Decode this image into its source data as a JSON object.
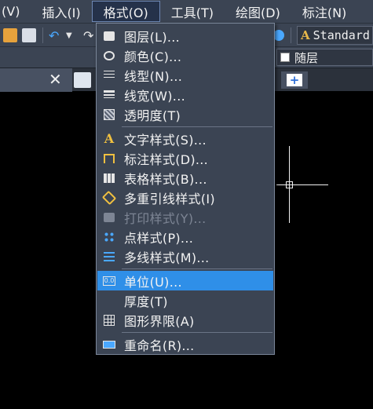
{
  "menubar": {
    "items": [
      {
        "label": "(V)"
      },
      {
        "label": "插入(I)"
      },
      {
        "label": "格式(O)"
      },
      {
        "label": "工具(T)"
      },
      {
        "label": "绘图(D)"
      },
      {
        "label": "标注(N)"
      }
    ]
  },
  "toolbar": {
    "text_style": "Standard"
  },
  "layer_bar": {
    "color_value": "随层"
  },
  "format_menu": {
    "items": [
      {
        "label": "图层(L)...",
        "icon": "layers-icon"
      },
      {
        "label": "颜色(C)...",
        "icon": "palette-icon"
      },
      {
        "label": "线型(N)...",
        "icon": "linetype-icon"
      },
      {
        "label": "线宽(W)...",
        "icon": "lineweight-icon"
      },
      {
        "label": "透明度(T)",
        "icon": "transparency-icon"
      },
      {
        "label": "文字样式(S)...",
        "icon": "text-style-icon"
      },
      {
        "label": "标注样式(D)...",
        "icon": "dimension-style-icon"
      },
      {
        "label": "表格样式(B)...",
        "icon": "table-style-icon"
      },
      {
        "label": "多重引线样式(I)",
        "icon": "multileader-style-icon"
      },
      {
        "label": "打印样式(Y)...",
        "icon": "plot-style-icon"
      },
      {
        "label": "点样式(P)...",
        "icon": "point-style-icon"
      },
      {
        "label": "多线样式(M)...",
        "icon": "multiline-style-icon"
      },
      {
        "label": "单位(U)...",
        "icon": "units-icon"
      },
      {
        "label": "厚度(T)",
        "icon": ""
      },
      {
        "label": "图形界限(A)",
        "icon": "drawing-limits-icon"
      },
      {
        "label": "重命名(R)...",
        "icon": "rename-icon"
      }
    ],
    "highlighted": "单位(U)...",
    "disabled": "打印样式(Y)..."
  },
  "colors": {
    "menu_bg": "#3b4453",
    "highlight": "#2f8fe8",
    "canvas": "#000000"
  }
}
